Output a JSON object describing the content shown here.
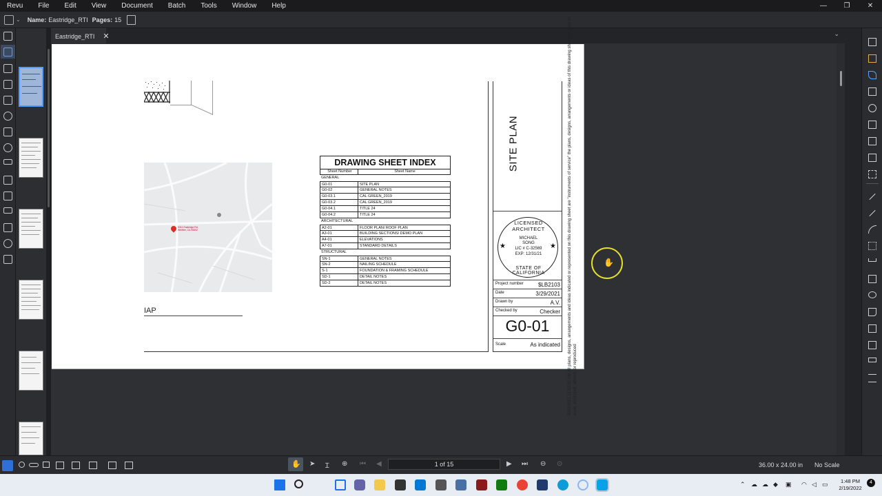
{
  "menubar": {
    "items": [
      "Revu",
      "File",
      "Edit",
      "View",
      "Document",
      "Batch",
      "Tools",
      "Window",
      "Help"
    ],
    "window_controls": [
      "—",
      "❐",
      "✕"
    ]
  },
  "propbar": {
    "name_label": "Name:",
    "name_value": "Eastridge_RTI",
    "pages_label": "Pages:",
    "pages_value": "15"
  },
  "tabs": [
    {
      "label": "Eastridge_RTI",
      "close": "✕"
    }
  ],
  "tab_dropdown": "⌄",
  "sheet": {
    "map_label": "IAP",
    "map_pin_label": "5311 Eastridge Rd, Whittier, CA 90602",
    "index": {
      "title": "DRAWING SHEET INDEX",
      "col_number": "Sheet Number",
      "col_name": "Sheet Name",
      "sections": [
        {
          "name": "GENERAL",
          "rows": [
            [
              "G0-01",
              "SITE PLAN"
            ],
            [
              "G0-02",
              "GENERAL NOTES"
            ],
            [
              "G0-03.1",
              "CAL GREEN_2019"
            ],
            [
              "G0-03.2",
              "CAL GREEN_2019"
            ],
            [
              "G0-04.1",
              "TITLE 24"
            ],
            [
              "G0-04.2",
              "TITLE 24"
            ]
          ]
        },
        {
          "name": "ARCHITECTURAL",
          "rows": [
            [
              "A2-01",
              "FLOOR PLAN/ ROOF PLAN"
            ],
            [
              "A3-01",
              "BUILDING SECTIONS/ DEMO PLAN"
            ],
            [
              "A4-01",
              "ELEVATIONS"
            ],
            [
              "A7-01",
              "STANDARD DETAILS"
            ]
          ]
        },
        {
          "name": "STRUCTURAL",
          "rows": [
            [
              "SN-1",
              "GENERAL NOTES"
            ],
            [
              "SN-2",
              "NAILING SCHEDULE"
            ],
            [
              "S-1",
              "FOUNDATION & FRAMING SCHEDULE"
            ],
            [
              "SD-1",
              "DETAIL NOTES"
            ],
            [
              "SD-2",
              "DETAIL NOTES"
            ]
          ]
        }
      ]
    },
    "title_block": {
      "sheet_title": "SITE PLAN",
      "stamp": {
        "ring_top": "LICENSED ARCHITECT",
        "ring_bottom": "STATE OF CALIFORNIA",
        "name_1": "MICHAEL",
        "name_2": "SONG",
        "lic": "LIC # C-32569",
        "exp": "EXP: 12/31/21"
      },
      "fields": [
        {
          "key": "Project number",
          "value": "$LB2103"
        },
        {
          "key": "Date",
          "value": "3/29/2021"
        },
        {
          "key": "Drawn by",
          "value": "A.V."
        },
        {
          "key": "Checked by",
          "value": "Checker"
        }
      ],
      "sheet_number": "G0-01",
      "scale_key": "Scale",
      "scale_value": "As indicated",
      "disclaimer": "5/20/2021 11:32:01 AM   All plans, designs, arrangements and ideas indicated or represented on this drawing sheet are \"instruments of service\" the plans, designs, arrangements or ideas of this drawing sheet/set shall be used, disclosed, altered, or reproduced"
    }
  },
  "statusbar": {
    "page_indicator": "1 of 15",
    "dimensions": "36.00 x 24.00 in",
    "scale": "No Scale"
  },
  "taskbar": {
    "time": "1:48 PM",
    "date": "2/19/2022",
    "notification_count": "4"
  },
  "colors": {
    "accent": "#4f9bff",
    "cursor_highlight": "#e5e02a",
    "pin": "#d93025"
  }
}
